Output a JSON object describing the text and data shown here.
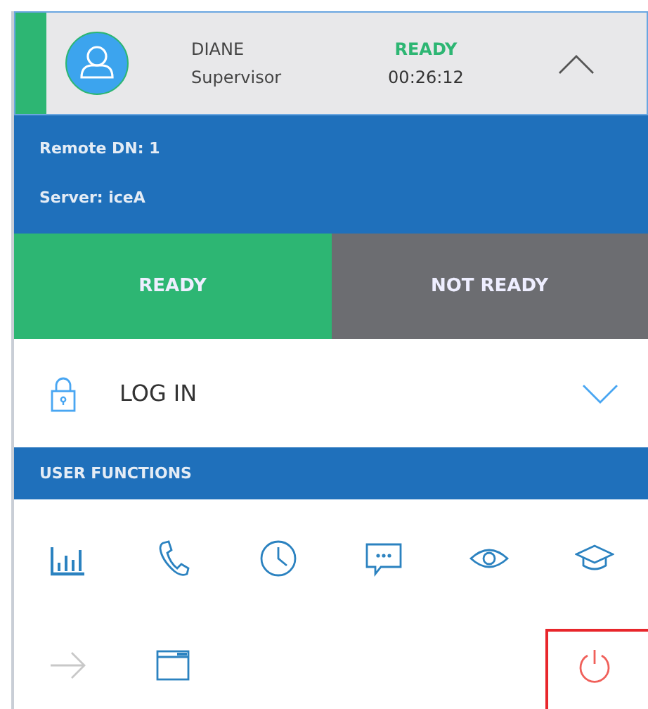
{
  "agent": {
    "name": "DIANE",
    "role": "Supervisor",
    "status": "READY",
    "kind": "ready",
    "timer": "00:26:12",
    "expanded": true
  },
  "details": [
    {
      "label": "Remote DN:",
      "value": "1"
    },
    {
      "label": "Server:",
      "value": "iceA"
    }
  ],
  "state_buttons": [
    {
      "label": "READY",
      "kind": "ready"
    },
    {
      "label": "NOT READY",
      "kind": "not_ready"
    }
  ],
  "login": {
    "label": "LOG IN",
    "expanded": false
  },
  "section_title": "USER FUNCTIONS",
  "function_rows": [
    [
      {
        "kind": "chart",
        "disabled": false,
        "highlighted": false
      },
      {
        "kind": "phone",
        "disabled": false,
        "highlighted": false
      },
      {
        "kind": "clock",
        "disabled": false,
        "highlighted": false
      },
      {
        "kind": "chat",
        "disabled": false,
        "highlighted": false
      },
      {
        "kind": "eye",
        "disabled": false,
        "highlighted": false
      },
      {
        "kind": "cap",
        "disabled": false,
        "highlighted": false
      }
    ],
    [
      {
        "kind": "arrow",
        "disabled": true,
        "highlighted": false
      },
      {
        "kind": "window",
        "disabled": false,
        "highlighted": false
      },
      null,
      null,
      null,
      {
        "kind": "power",
        "disabled": false,
        "highlighted": true
      }
    ]
  ]
}
